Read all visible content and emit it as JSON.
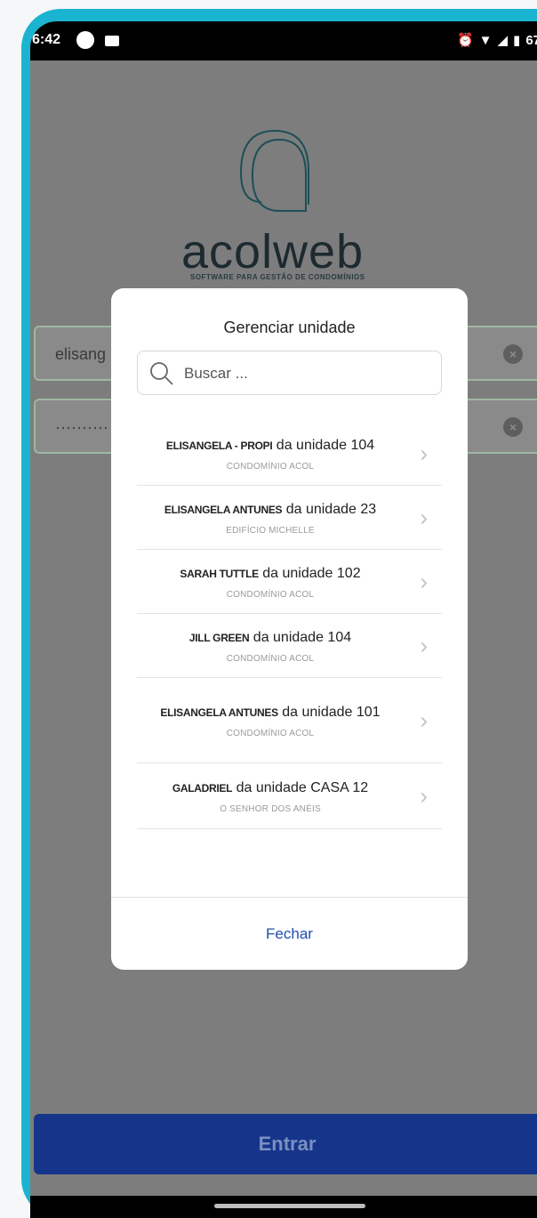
{
  "status_bar": {
    "time": "6:42",
    "battery": "67"
  },
  "brand": {
    "name": "acolweb",
    "tagline": "SOFTWARE PARA GESTÃO DE CONDOMÍNIOS"
  },
  "login": {
    "username_value": "elisang",
    "password_value": "··········",
    "submit_label": "Entrar"
  },
  "modal": {
    "title": "Gerenciar unidade",
    "search_placeholder": "Buscar ...",
    "items": [
      {
        "name": "ELISANGELA - PROPI",
        "suffix": " da unidade 104",
        "condo": "CONDOMÍNIO ACOL"
      },
      {
        "name": "ELISANGELA ANTUNES",
        "suffix": " da unidade 23",
        "condo": "EDIFÍCIO MICHELLE"
      },
      {
        "name": "SARAH TUTTLE",
        "suffix": " da unidade 102",
        "condo": "CONDOMÍNIO ACOL"
      },
      {
        "name": "JILL GREEN",
        "suffix": " da unidade 104",
        "condo": "CONDOMÍNIO ACOL"
      },
      {
        "name": "ELISANGELA ANTUNES",
        "suffix": " da unidade 101",
        "condo": "CONDOMÍNIO ACOL"
      },
      {
        "name": "GALADRIEL",
        "suffix": " da unidade CASA 12",
        "condo": "O SENHOR DOS ANÉIS"
      }
    ],
    "close_label": "Fechar"
  },
  "colors": {
    "frame": "#1ab4d1",
    "primary": "#15358a",
    "link": "#1f4fae",
    "overlay": "#7d7d7d"
  },
  "icons": {
    "search": "search-icon",
    "chevron": "chevron-right-icon",
    "clear": "clear-icon"
  }
}
